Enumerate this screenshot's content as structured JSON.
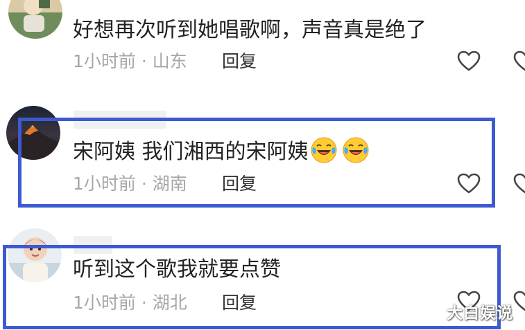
{
  "comments": [
    {
      "text": "好想再次听到她唱歌啊，声音真是绝了",
      "time": "1小时前",
      "location": "山东",
      "reply_label": "回复"
    },
    {
      "text": "宋阿姨 我们湘西的宋阿姨",
      "emojis": [
        "laugh-cry-emoji",
        "laugh-cry-emoji"
      ],
      "time": "1小时前",
      "location": "湖南",
      "reply_label": "回复"
    },
    {
      "text": "听到这个歌我就要点赞",
      "time": "1小时前",
      "location": "湖北",
      "reply_label": "回复"
    }
  ],
  "meta_separator": " · ",
  "highlight_color": "#3d5ad0",
  "watermark": "大白娱说"
}
